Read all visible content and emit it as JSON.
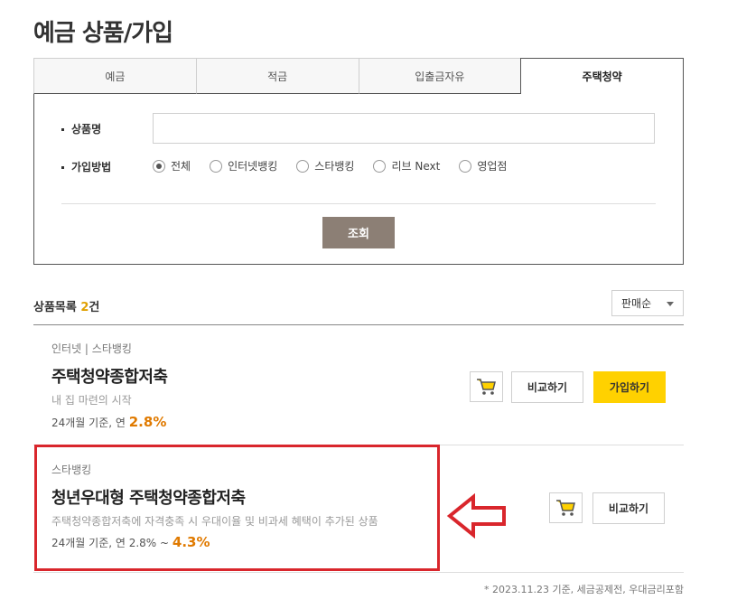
{
  "page": {
    "title": "예금 상품/가입"
  },
  "tabs": [
    {
      "label": "예금",
      "active": false
    },
    {
      "label": "적금",
      "active": false
    },
    {
      "label": "입출금자유",
      "active": false
    },
    {
      "label": "주택청약",
      "active": true
    }
  ],
  "search": {
    "name_label": "상품명",
    "name_value": "",
    "name_placeholder": "",
    "method_label": "가입방법",
    "methods": [
      {
        "label": "전체",
        "checked": true
      },
      {
        "label": "인터넷뱅킹",
        "checked": false
      },
      {
        "label": "스타뱅킹",
        "checked": false
      },
      {
        "label": "리브 Next",
        "checked": false
      },
      {
        "label": "영업점",
        "checked": false
      }
    ],
    "search_button": "조회"
  },
  "list": {
    "count_prefix": "상품목록",
    "count": "2",
    "count_suffix": "건",
    "sort_selected": "판매순"
  },
  "products": [
    {
      "channel": "인터넷 | 스타뱅킹",
      "name": "주택청약종합저축",
      "desc": "내 집 마련의 시작",
      "rate_prefix": "24개월 기준, 연",
      "rate": "2.8%",
      "compare_label": "비교하기",
      "join_label": "가입하기"
    },
    {
      "channel": "스타뱅킹",
      "name": "청년우대형 주택청약종합저축",
      "desc": "주택청약종합저축에 자격충족 시 우대이율 및 비과세 혜택이 추가된 상품",
      "rate_prefix": "24개월 기준, 연 2.8% ~",
      "rate": "4.3%",
      "compare_label": "비교하기"
    }
  ],
  "footnote": "* 2023.11.23 기준, 세금공제전, 우대금리포함",
  "colors": {
    "accent_yellow": "#ffd100",
    "rate_orange": "#e07a00",
    "button_brown": "#8c7f75",
    "annotation_red": "#d9262c"
  }
}
